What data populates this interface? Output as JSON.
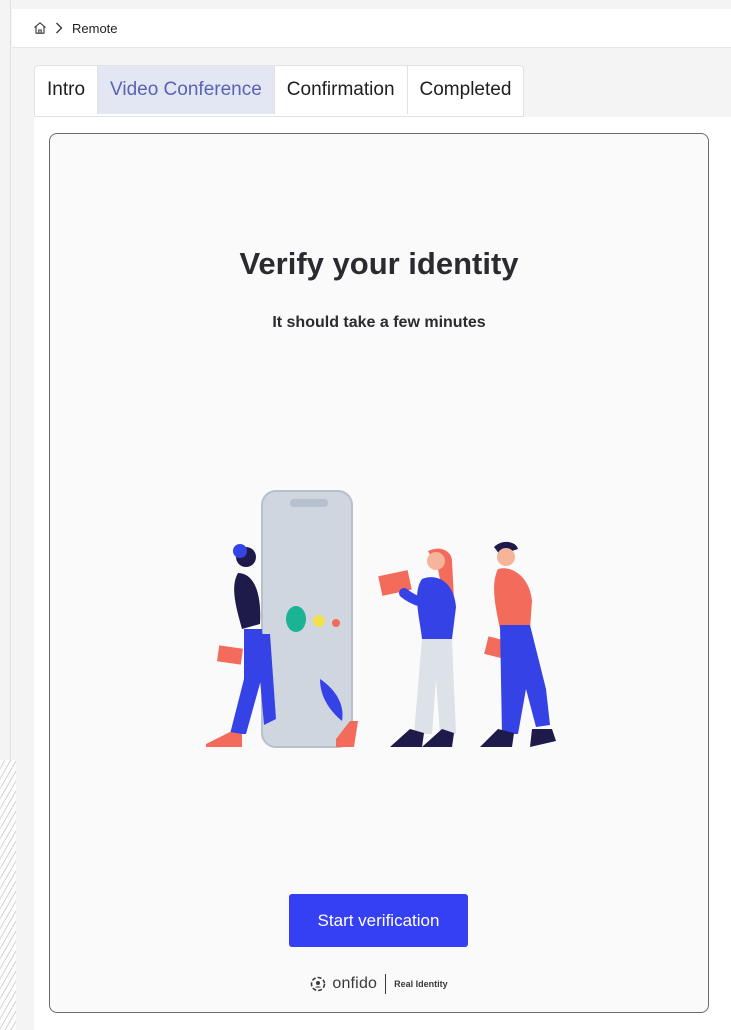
{
  "breadcrumb": {
    "home_icon": "home-icon",
    "separator_icon": "chevron-right-icon",
    "current": "Remote"
  },
  "tabs": [
    {
      "label": "Intro",
      "active": false
    },
    {
      "label": "Video Conference",
      "active": true
    },
    {
      "label": "Confirmation",
      "active": false
    },
    {
      "label": "Completed",
      "active": false
    }
  ],
  "card": {
    "title": "Verify your identity",
    "subtitle": "It should take a few minutes",
    "illustration_icon": "identity-verification-illustration",
    "button_label": "Start verification",
    "brand": {
      "logo_icon": "onfido-logo-icon",
      "name": "onfido",
      "tagline": "Real Identity"
    }
  },
  "colors": {
    "accent": "#353ff4",
    "active_tab_bg": "#e3e6f3",
    "active_tab_text": "#5a62b4",
    "illustration_blue": "#3543e6",
    "illustration_coral": "#f26b5b",
    "illustration_navy": "#1e1b4b",
    "phone_gray": "#cfd6e0"
  }
}
